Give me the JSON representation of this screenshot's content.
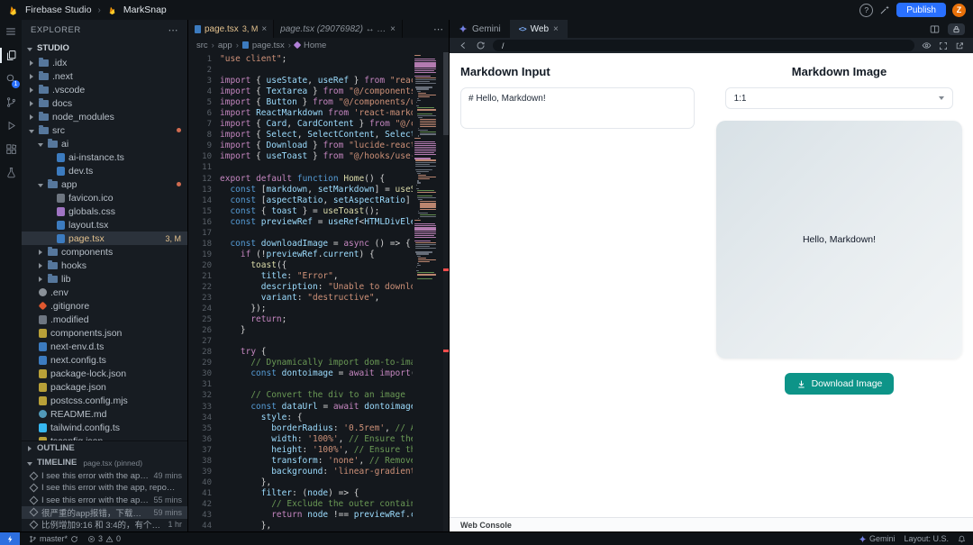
{
  "topbar": {
    "app_name": "Firebase Studio",
    "separator": "›",
    "project_name": "MarkSnap",
    "help_label": "?",
    "publish_label": "Publish",
    "avatar_initial": "Z"
  },
  "activity_bar": {
    "badge": "1"
  },
  "explorer": {
    "title": "EXPLORER",
    "section_label": "STUDIO",
    "tree": [
      {
        "label": ".idx",
        "type": "folder",
        "depth": 0,
        "icon": "folder"
      },
      {
        "label": ".next",
        "type": "folder",
        "depth": 0,
        "icon": "folder"
      },
      {
        "label": ".vscode",
        "type": "folder",
        "depth": 0,
        "icon": "folder"
      },
      {
        "label": "docs",
        "type": "folder",
        "depth": 0,
        "icon": "folder"
      },
      {
        "label": "node_modules",
        "type": "folder",
        "depth": 0,
        "icon": "folder"
      },
      {
        "label": "src",
        "type": "folder",
        "depth": 0,
        "icon": "folder",
        "expanded": true,
        "dot": true
      },
      {
        "label": "ai",
        "type": "folder",
        "depth": 1,
        "icon": "folder",
        "expanded": true
      },
      {
        "label": "ai-instance.ts",
        "type": "file",
        "depth": 2,
        "icon": "ts"
      },
      {
        "label": "dev.ts",
        "type": "file",
        "depth": 2,
        "icon": "ts"
      },
      {
        "label": "app",
        "type": "folder",
        "depth": 1,
        "icon": "folder",
        "expanded": true,
        "dot": true
      },
      {
        "label": "favicon.ico",
        "type": "file",
        "depth": 2,
        "icon": "image"
      },
      {
        "label": "globals.css",
        "type": "file",
        "depth": 2,
        "icon": "css"
      },
      {
        "label": "layout.tsx",
        "type": "file",
        "depth": 2,
        "icon": "ts"
      },
      {
        "label": "page.tsx",
        "type": "file",
        "depth": 2,
        "icon": "ts",
        "selected": true,
        "modified": true,
        "badge": "3, M"
      },
      {
        "label": "components",
        "type": "folder",
        "depth": 1,
        "icon": "folder"
      },
      {
        "label": "hooks",
        "type": "folder",
        "depth": 1,
        "icon": "folder"
      },
      {
        "label": "lib",
        "type": "folder",
        "depth": 1,
        "icon": "folder"
      },
      {
        "label": ".env",
        "type": "file",
        "depth": 0,
        "icon": "gear"
      },
      {
        "label": ".gitignore",
        "type": "file",
        "depth": 0,
        "icon": "git"
      },
      {
        "label": ".modified",
        "type": "file",
        "depth": 0,
        "icon": "file"
      },
      {
        "label": "components.json",
        "type": "file",
        "depth": 0,
        "icon": "json"
      },
      {
        "label": "next-env.d.ts",
        "type": "file",
        "depth": 0,
        "icon": "ts"
      },
      {
        "label": "next.config.ts",
        "type": "file",
        "depth": 0,
        "icon": "ts"
      },
      {
        "label": "package-lock.json",
        "type": "file",
        "depth": 0,
        "icon": "json"
      },
      {
        "label": "package.json",
        "type": "file",
        "depth": 0,
        "icon": "json"
      },
      {
        "label": "postcss.config.mjs",
        "type": "file",
        "depth": 0,
        "icon": "js"
      },
      {
        "label": "README.md",
        "type": "file",
        "depth": 0,
        "icon": "md"
      },
      {
        "label": "tailwind.config.ts",
        "type": "file",
        "depth": 0,
        "icon": "tailwind"
      },
      {
        "label": "tsconfig.json",
        "type": "file",
        "depth": 0,
        "icon": "json"
      }
    ],
    "outline_label": "OUTLINE",
    "timeline_label": "TIMELINE",
    "timeline_context": "page.tsx (pinned)",
    "timeline_items": [
      {
        "text": "I see this error with the app, re...",
        "time": "49 mins"
      },
      {
        "text": "I see this error with the app, reported...",
        "time": ""
      },
      {
        "text": "I see this error with the app, re...",
        "time": "55 mins"
      },
      {
        "text": "很严重的app报错，下载下来的...",
        "time": "59 mins",
        "selected": true
      },
      {
        "text": "比例增加9:16 和 3:4的，有个宗旨...",
        "time": "1 hr"
      }
    ]
  },
  "editor": {
    "tabs": [
      {
        "label": "page.tsx",
        "badge": "3, M",
        "active": true
      },
      {
        "label": "page.tsx (29076982) ↔ page.tsx (a3...)",
        "active": false
      }
    ],
    "breadcrumb": [
      "src",
      "app",
      "page.tsx",
      "Home"
    ],
    "error_line": 30,
    "error_token": "'dom-t",
    "lines": [
      "\"use client\";",
      "",
      "import { useState, useRef } from \"react\";",
      "import { Textarea } from \"@/components/ui/te",
      "import { Button } from \"@/components/ui/butt",
      "import ReactMarkdown from 'react-markdown';",
      "import { Card, CardContent } from \"@/compone",
      "import { Select, SelectContent, SelectItem,",
      "import { Download } from \"lucide-react\";",
      "import { useToast } from \"@/hooks/use-toast\"",
      "",
      "export default function Home() {",
      "  const [markdown, setMarkdown] = useState(\"",
      "  const [aspectRatio, setAspectRatio] = useS",
      "  const { toast } = useToast();",
      "  const previewRef = useRef<HTMLDivElement>(",
      "",
      "  const downloadImage = async () => {",
      "    if (!previewRef.current) {",
      "      toast({",
      "        title: \"Error\",",
      "        description: \"Unable to download ima",
      "        variant: \"destructive\",",
      "      });",
      "      return;",
      "    }",
      "",
      "    try {",
      "      // Dynamically import dom-to-image",
      "      const dontoimage = await import('dom-t",
      "",
      "      // Convert the div to an image",
      "      const dataUrl = await dontoimage.toPng",
      "        style: {",
      "          borderRadius: '0.5rem', // Apply r",
      "          width: '100%', // Ensure the width",
      "          height: '100%', // Ensure the heig",
      "          transform: 'none', // Remove any t",
      "          background: 'linear-gradient(to bo",
      "        },",
      "        filter: (node) => {",
      "          // Exclude the outer container to",
      "          return node !== previewRef.current",
      "        },"
    ]
  },
  "preview": {
    "tabs": {
      "gemini_label": "Gemini",
      "web_label": "Web"
    },
    "url": "/",
    "page": {
      "input_heading": "Markdown Input",
      "input_value": "# Hello, Markdown!",
      "image_heading": "Markdown Image",
      "aspect_ratio_value": "1:1",
      "preview_text": "Hello, Markdown!",
      "download_label": "Download Image"
    },
    "console_label": "Web Console"
  },
  "statusbar": {
    "branch": "master*",
    "error_count": "3",
    "warning_count": "0",
    "gemini_label": "Gemini",
    "layout_label": "Layout: U.S."
  },
  "colors": {
    "publish_blue": "#2970ff",
    "download_teal": "#0d9488",
    "avatar_orange": "#e8710a",
    "modified_orange": "#e2c08d",
    "error_red": "#f14c4c"
  }
}
